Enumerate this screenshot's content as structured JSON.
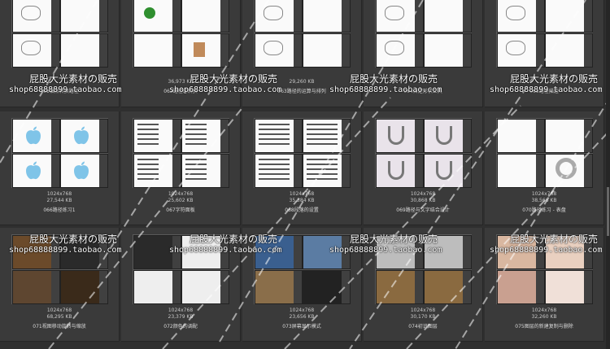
{
  "items": [
    {
      "id": "061",
      "dims": "",
      "size": "",
      "name": "061锚点转换路径",
      "theme": "line"
    },
    {
      "id": "062",
      "dims": "",
      "size": "36,973 KB",
      "name": "062路径的转换",
      "theme": "snail"
    },
    {
      "id": "063",
      "dims": "",
      "size": "29,260 KB",
      "name": "063路径的运算与排列",
      "theme": "line"
    },
    {
      "id": "064",
      "dims": "",
      "size": "",
      "name": "064自定形状工具",
      "theme": "line"
    },
    {
      "id": "065",
      "dims": "",
      "size": "",
      "name": "065路径描边",
      "theme": "line"
    },
    {
      "id": "066",
      "dims": "1024x768",
      "size": "27,544 KB",
      "name": "066路径练习1",
      "theme": "apple"
    },
    {
      "id": "067",
      "dims": "1024x768",
      "size": "25,602 KB",
      "name": "067字符面板",
      "theme": "text"
    },
    {
      "id": "068",
      "dims": "1024x768",
      "size": "35,384 KB",
      "name": "068段落的设置",
      "theme": "doc"
    },
    {
      "id": "069",
      "dims": "1024x768",
      "size": "30,868 KB",
      "name": "069路径与文字结合设计",
      "theme": "hook"
    },
    {
      "id": "070",
      "dims": "1024x768",
      "size": "38,566 KB",
      "name": "070路径练习 - 表盘",
      "theme": "dial"
    },
    {
      "id": "071",
      "dims": "1024x768",
      "size": "68,295 KB",
      "name": "071视图移动旋转与缩放",
      "theme": "photo"
    },
    {
      "id": "072",
      "dims": "1024x768",
      "size": "23,379 KB",
      "name": "072颜色的调配",
      "theme": "color"
    },
    {
      "id": "073",
      "dims": "1024x768",
      "size": "23,656 KB",
      "name": "073屏幕显示模式",
      "theme": "landscape"
    },
    {
      "id": "074",
      "dims": "1024x768",
      "size": "30,170 KB",
      "name": "074初识图层",
      "theme": "bullet"
    },
    {
      "id": "075",
      "dims": "1024x768",
      "size": "32,260 KB",
      "name": "075图层的新建复制与删除",
      "theme": "kids"
    }
  ],
  "watermark": {
    "text": "屁股大光素材の贩売",
    "url": "shop68888899.taobao.com"
  },
  "colors": {
    "background": "#2f2f2f",
    "cell": "#3a3a3a",
    "apple": "#7fc4e8"
  }
}
